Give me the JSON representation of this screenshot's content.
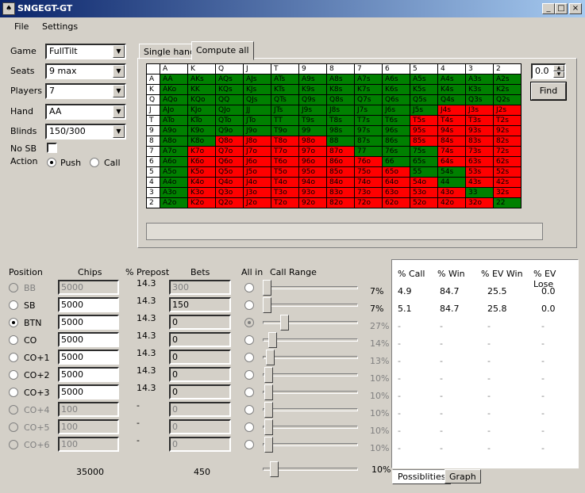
{
  "window": {
    "title": "SNGEGT-GT"
  },
  "menu": [
    "File",
    "Settings"
  ],
  "settings": {
    "game_label": "Game",
    "game_value": "FullTilt",
    "seats_label": "Seats",
    "seats_value": "9 max",
    "players_label": "Players",
    "players_value": "7",
    "hand_label": "Hand",
    "hand_value": "AA",
    "blinds_label": "Blinds",
    "blinds_value": "150/300",
    "nosb_label": "No SB",
    "action_label": "Action",
    "push_label": "Push",
    "call_label": "Call"
  },
  "tabs": {
    "single": "Single hand",
    "compute": "Compute all"
  },
  "hand_grid": {
    "cols": [
      "A",
      "K",
      "Q",
      "J",
      "T",
      "9",
      "8",
      "7",
      "6",
      "5",
      "4",
      "3",
      "2"
    ],
    "rows": [
      {
        "r": "A",
        "cells": [
          [
            "AA",
            "g"
          ],
          [
            "AKs",
            "g"
          ],
          [
            "AQs",
            "g"
          ],
          [
            "AJs",
            "g"
          ],
          [
            "ATs",
            "g"
          ],
          [
            "A9s",
            "g"
          ],
          [
            "A8s",
            "g"
          ],
          [
            "A7s",
            "g"
          ],
          [
            "A6s",
            "g"
          ],
          [
            "A5s",
            "g"
          ],
          [
            "A4s",
            "g"
          ],
          [
            "A3s",
            "g"
          ],
          [
            "A2s",
            "g"
          ]
        ]
      },
      {
        "r": "K",
        "cells": [
          [
            "AKo",
            "g"
          ],
          [
            "KK",
            "g"
          ],
          [
            "KQs",
            "g"
          ],
          [
            "KJs",
            "g"
          ],
          [
            "KTs",
            "g"
          ],
          [
            "K9s",
            "g"
          ],
          [
            "K8s",
            "g"
          ],
          [
            "K7s",
            "g"
          ],
          [
            "K6s",
            "g"
          ],
          [
            "K5s",
            "g"
          ],
          [
            "K4s",
            "g"
          ],
          [
            "K3s",
            "g"
          ],
          [
            "K2s",
            "g"
          ]
        ]
      },
      {
        "r": "Q",
        "cells": [
          [
            "AQo",
            "g"
          ],
          [
            "KQo",
            "g"
          ],
          [
            "QQ",
            "g"
          ],
          [
            "QJs",
            "g"
          ],
          [
            "QTs",
            "g"
          ],
          [
            "Q9s",
            "g"
          ],
          [
            "Q8s",
            "g"
          ],
          [
            "Q7s",
            "g"
          ],
          [
            "Q6s",
            "g"
          ],
          [
            "Q5s",
            "g"
          ],
          [
            "Q4s",
            "g"
          ],
          [
            "Q3s",
            "g"
          ],
          [
            "Q2s",
            "g"
          ]
        ]
      },
      {
        "r": "J",
        "cells": [
          [
            "AJo",
            "g"
          ],
          [
            "KJo",
            "g"
          ],
          [
            "QJo",
            "g"
          ],
          [
            "JJ",
            "g"
          ],
          [
            "JTs",
            "g"
          ],
          [
            "J9s",
            "g"
          ],
          [
            "J8s",
            "g"
          ],
          [
            "J7s",
            "g"
          ],
          [
            "J6s",
            "g"
          ],
          [
            "J5s",
            "g"
          ],
          [
            "J4s",
            "r"
          ],
          [
            "J3s",
            "r"
          ],
          [
            "J2s",
            "r"
          ]
        ]
      },
      {
        "r": "T",
        "cells": [
          [
            "ATo",
            "g"
          ],
          [
            "KTo",
            "g"
          ],
          [
            "QTo",
            "g"
          ],
          [
            "JTo",
            "g"
          ],
          [
            "TT",
            "g"
          ],
          [
            "T9s",
            "g"
          ],
          [
            "T8s",
            "g"
          ],
          [
            "T7s",
            "g"
          ],
          [
            "T6s",
            "g"
          ],
          [
            "T5s",
            "r"
          ],
          [
            "T4s",
            "r"
          ],
          [
            "T3s",
            "r"
          ],
          [
            "T2s",
            "r"
          ]
        ]
      },
      {
        "r": "9",
        "cells": [
          [
            "A9o",
            "g"
          ],
          [
            "K9o",
            "g"
          ],
          [
            "Q9o",
            "g"
          ],
          [
            "J9o",
            "g"
          ],
          [
            "T9o",
            "g"
          ],
          [
            "99",
            "g"
          ],
          [
            "98s",
            "g"
          ],
          [
            "97s",
            "g"
          ],
          [
            "96s",
            "g"
          ],
          [
            "95s",
            "r"
          ],
          [
            "94s",
            "r"
          ],
          [
            "93s",
            "r"
          ],
          [
            "92s",
            "r"
          ]
        ]
      },
      {
        "r": "8",
        "cells": [
          [
            "A8o",
            "g"
          ],
          [
            "K8o",
            "g"
          ],
          [
            "Q8o",
            "r"
          ],
          [
            "J8o",
            "r"
          ],
          [
            "T8o",
            "r"
          ],
          [
            "98o",
            "r"
          ],
          [
            "88",
            "g"
          ],
          [
            "87s",
            "g"
          ],
          [
            "86s",
            "g"
          ],
          [
            "85s",
            "r"
          ],
          [
            "84s",
            "r"
          ],
          [
            "83s",
            "r"
          ],
          [
            "82s",
            "r"
          ]
        ]
      },
      {
        "r": "7",
        "cells": [
          [
            "A7o",
            "g"
          ],
          [
            "K7o",
            "r"
          ],
          [
            "Q7o",
            "r"
          ],
          [
            "J7o",
            "r"
          ],
          [
            "T7o",
            "r"
          ],
          [
            "97o",
            "r"
          ],
          [
            "87o",
            "r"
          ],
          [
            "77",
            "g"
          ],
          [
            "76s",
            "g"
          ],
          [
            "75s",
            "g"
          ],
          [
            "74s",
            "r"
          ],
          [
            "73s",
            "r"
          ],
          [
            "72s",
            "r"
          ]
        ]
      },
      {
        "r": "6",
        "cells": [
          [
            "A6o",
            "g"
          ],
          [
            "K6o",
            "r"
          ],
          [
            "Q6o",
            "r"
          ],
          [
            "J6o",
            "r"
          ],
          [
            "T6o",
            "r"
          ],
          [
            "96o",
            "r"
          ],
          [
            "86o",
            "r"
          ],
          [
            "76o",
            "r"
          ],
          [
            "66",
            "g"
          ],
          [
            "65s",
            "g"
          ],
          [
            "64s",
            "r"
          ],
          [
            "63s",
            "r"
          ],
          [
            "62s",
            "r"
          ]
        ]
      },
      {
        "r": "5",
        "cells": [
          [
            "A5o",
            "g"
          ],
          [
            "K5o",
            "r"
          ],
          [
            "Q5o",
            "r"
          ],
          [
            "J5o",
            "r"
          ],
          [
            "T5o",
            "r"
          ],
          [
            "95o",
            "r"
          ],
          [
            "85o",
            "r"
          ],
          [
            "75o",
            "r"
          ],
          [
            "65o",
            "r"
          ],
          [
            "55",
            "g"
          ],
          [
            "54s",
            "g"
          ],
          [
            "53s",
            "r"
          ],
          [
            "52s",
            "r"
          ]
        ]
      },
      {
        "r": "4",
        "cells": [
          [
            "A4o",
            "g"
          ],
          [
            "K4o",
            "r"
          ],
          [
            "Q4o",
            "r"
          ],
          [
            "J4o",
            "r"
          ],
          [
            "T4o",
            "r"
          ],
          [
            "94o",
            "r"
          ],
          [
            "84o",
            "r"
          ],
          [
            "74o",
            "r"
          ],
          [
            "64o",
            "r"
          ],
          [
            "54o",
            "r"
          ],
          [
            "44",
            "g"
          ],
          [
            "43s",
            "r"
          ],
          [
            "42s",
            "r"
          ]
        ]
      },
      {
        "r": "3",
        "cells": [
          [
            "A3o",
            "g"
          ],
          [
            "K3o",
            "r"
          ],
          [
            "Q3o",
            "r"
          ],
          [
            "J3o",
            "r"
          ],
          [
            "T3o",
            "r"
          ],
          [
            "93o",
            "r"
          ],
          [
            "83o",
            "r"
          ],
          [
            "73o",
            "r"
          ],
          [
            "63o",
            "r"
          ],
          [
            "53o",
            "r"
          ],
          [
            "43o",
            "r"
          ],
          [
            "33",
            "g"
          ],
          [
            "32s",
            "r"
          ]
        ]
      },
      {
        "r": "2",
        "cells": [
          [
            "A2o",
            "g"
          ],
          [
            "K2o",
            "r"
          ],
          [
            "Q2o",
            "r"
          ],
          [
            "J2o",
            "r"
          ],
          [
            "T2o",
            "r"
          ],
          [
            "92o",
            "r"
          ],
          [
            "82o",
            "r"
          ],
          [
            "72o",
            "r"
          ],
          [
            "62o",
            "r"
          ],
          [
            "52o",
            "r"
          ],
          [
            "42o",
            "r"
          ],
          [
            "32o",
            "r"
          ],
          [
            "22",
            "g"
          ]
        ]
      }
    ]
  },
  "find": {
    "value": "0.0",
    "button": "Find"
  },
  "table_headers": {
    "position": "Position",
    "chips": "Chips",
    "prepost": "% Prepost",
    "bets": "Bets",
    "allin": "All in",
    "range": "Call Range"
  },
  "positions": [
    {
      "name": "BB",
      "chips": "5000",
      "prepost": "14.3",
      "bets": "300",
      "range": "7%",
      "enabled": false,
      "selected": false,
      "allin_on": false
    },
    {
      "name": "SB",
      "chips": "5000",
      "prepost": "14.3",
      "bets": "150",
      "range": "7%",
      "enabled": true,
      "selected": false,
      "allin_on": false
    },
    {
      "name": "BTN",
      "chips": "5000",
      "prepost": "14.3",
      "bets": "0",
      "range": "27%",
      "enabled": true,
      "selected": true,
      "allin_on": true
    },
    {
      "name": "CO",
      "chips": "5000",
      "prepost": "14.3",
      "bets": "0",
      "range": "14%",
      "enabled": true,
      "selected": false,
      "allin_on": false
    },
    {
      "name": "CO+1",
      "chips": "5000",
      "prepost": "14.3",
      "bets": "0",
      "range": "13%",
      "enabled": true,
      "selected": false,
      "allin_on": false
    },
    {
      "name": "CO+2",
      "chips": "5000",
      "prepost": "14.3",
      "bets": "0",
      "range": "10%",
      "enabled": true,
      "selected": false,
      "allin_on": false
    },
    {
      "name": "CO+3",
      "chips": "5000",
      "prepost": "14.3",
      "bets": "0",
      "range": "10%",
      "enabled": true,
      "selected": false,
      "allin_on": false
    },
    {
      "name": "CO+4",
      "chips": "100",
      "prepost": "-",
      "bets": "0",
      "range": "10%",
      "enabled": false,
      "selected": false,
      "allin_on": false
    },
    {
      "name": "CO+5",
      "chips": "100",
      "prepost": "-",
      "bets": "0",
      "range": "10%",
      "enabled": false,
      "selected": false,
      "allin_on": false
    },
    {
      "name": "CO+6",
      "chips": "100",
      "prepost": "-",
      "bets": "0",
      "range": "10%",
      "enabled": false,
      "selected": false,
      "allin_on": false
    }
  ],
  "totals": {
    "chips": "35000",
    "bets": "450",
    "range": "10%"
  },
  "results": {
    "headers": [
      "% Call",
      "% Win",
      "% EV Win",
      "% EV Lose"
    ],
    "rows": [
      [
        "4.9",
        "84.7",
        "25.5",
        "0.0"
      ],
      [
        "5.1",
        "84.7",
        "25.8",
        "0.0"
      ],
      [
        "-",
        "-",
        "-",
        "-"
      ],
      [
        "-",
        "-",
        "-",
        "-"
      ],
      [
        "-",
        "-",
        "-",
        "-"
      ],
      [
        "-",
        "-",
        "-",
        "-"
      ],
      [
        "-",
        "-",
        "-",
        "-"
      ],
      [
        "-",
        "-",
        "-",
        "-"
      ],
      [
        "-",
        "-",
        "-",
        "-"
      ],
      [
        "-",
        "-",
        "-",
        "-"
      ]
    ],
    "tab_possibilities": "Possiblities",
    "tab_graph": "Graph"
  }
}
